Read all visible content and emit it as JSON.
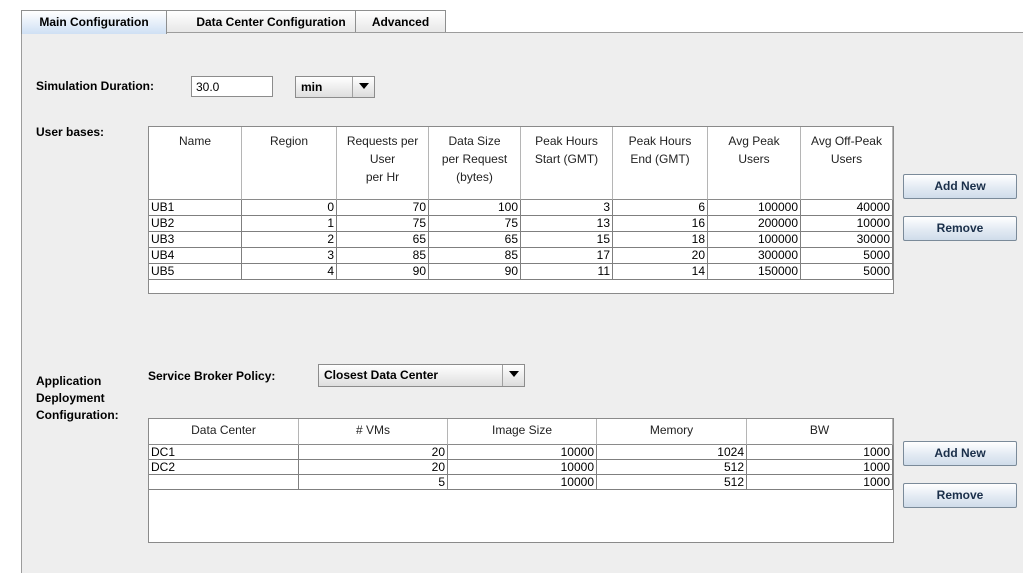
{
  "tabs": [
    {
      "label": "Main Configuration",
      "active": true
    },
    {
      "label": "Data Center Configuration",
      "active": false
    },
    {
      "label": "Advanced",
      "active": false
    }
  ],
  "simulation": {
    "label": "Simulation Duration:",
    "value": "30.0",
    "unit": "min"
  },
  "user_bases": {
    "label": "User bases:",
    "columns": [
      [
        "Name"
      ],
      [
        "Region"
      ],
      [
        "Requests per",
        "User",
        "per Hr"
      ],
      [
        "Data Size",
        "per Request",
        "(bytes)"
      ],
      [
        "Peak Hours",
        "Start (GMT)"
      ],
      [
        "Peak Hours",
        "End (GMT)"
      ],
      [
        "Avg Peak",
        "Users"
      ],
      [
        "Avg Off-Peak",
        "Users"
      ]
    ],
    "rows": [
      [
        "UB1",
        "0",
        "70",
        "100",
        "3",
        "6",
        "100000",
        "40000"
      ],
      [
        "UB2",
        "1",
        "75",
        "75",
        "13",
        "16",
        "200000",
        "10000"
      ],
      [
        "UB3",
        "2",
        "65",
        "65",
        "15",
        "18",
        "100000",
        "30000"
      ],
      [
        "UB4",
        "3",
        "85",
        "85",
        "17",
        "20",
        "300000",
        "5000"
      ],
      [
        "UB5",
        "4",
        "90",
        "90",
        "11",
        "14",
        "150000",
        "5000"
      ]
    ],
    "add_label": "Add New",
    "remove_label": "Remove"
  },
  "deployment": {
    "label_lines": [
      "Application",
      "Deployment",
      "Configuration:"
    ],
    "policy_label": "Service Broker Policy:",
    "policy_value": "Closest Data Center",
    "columns": [
      "Data Center",
      "# VMs",
      "Image Size",
      "Memory",
      "BW"
    ],
    "rows": [
      [
        "DC1",
        "20",
        "10000",
        "1024",
        "1000"
      ],
      [
        "DC2",
        "20",
        "10000",
        "512",
        "1000"
      ],
      [
        "",
        "5",
        "10000",
        "512",
        "1000"
      ]
    ],
    "add_label": "Add New",
    "remove_label": "Remove"
  },
  "colors": {
    "panel_bg": "#eeeeee",
    "active_tab": "#cfe0f4"
  },
  "icons": {
    "dropdown": "chevron-down-icon"
  }
}
